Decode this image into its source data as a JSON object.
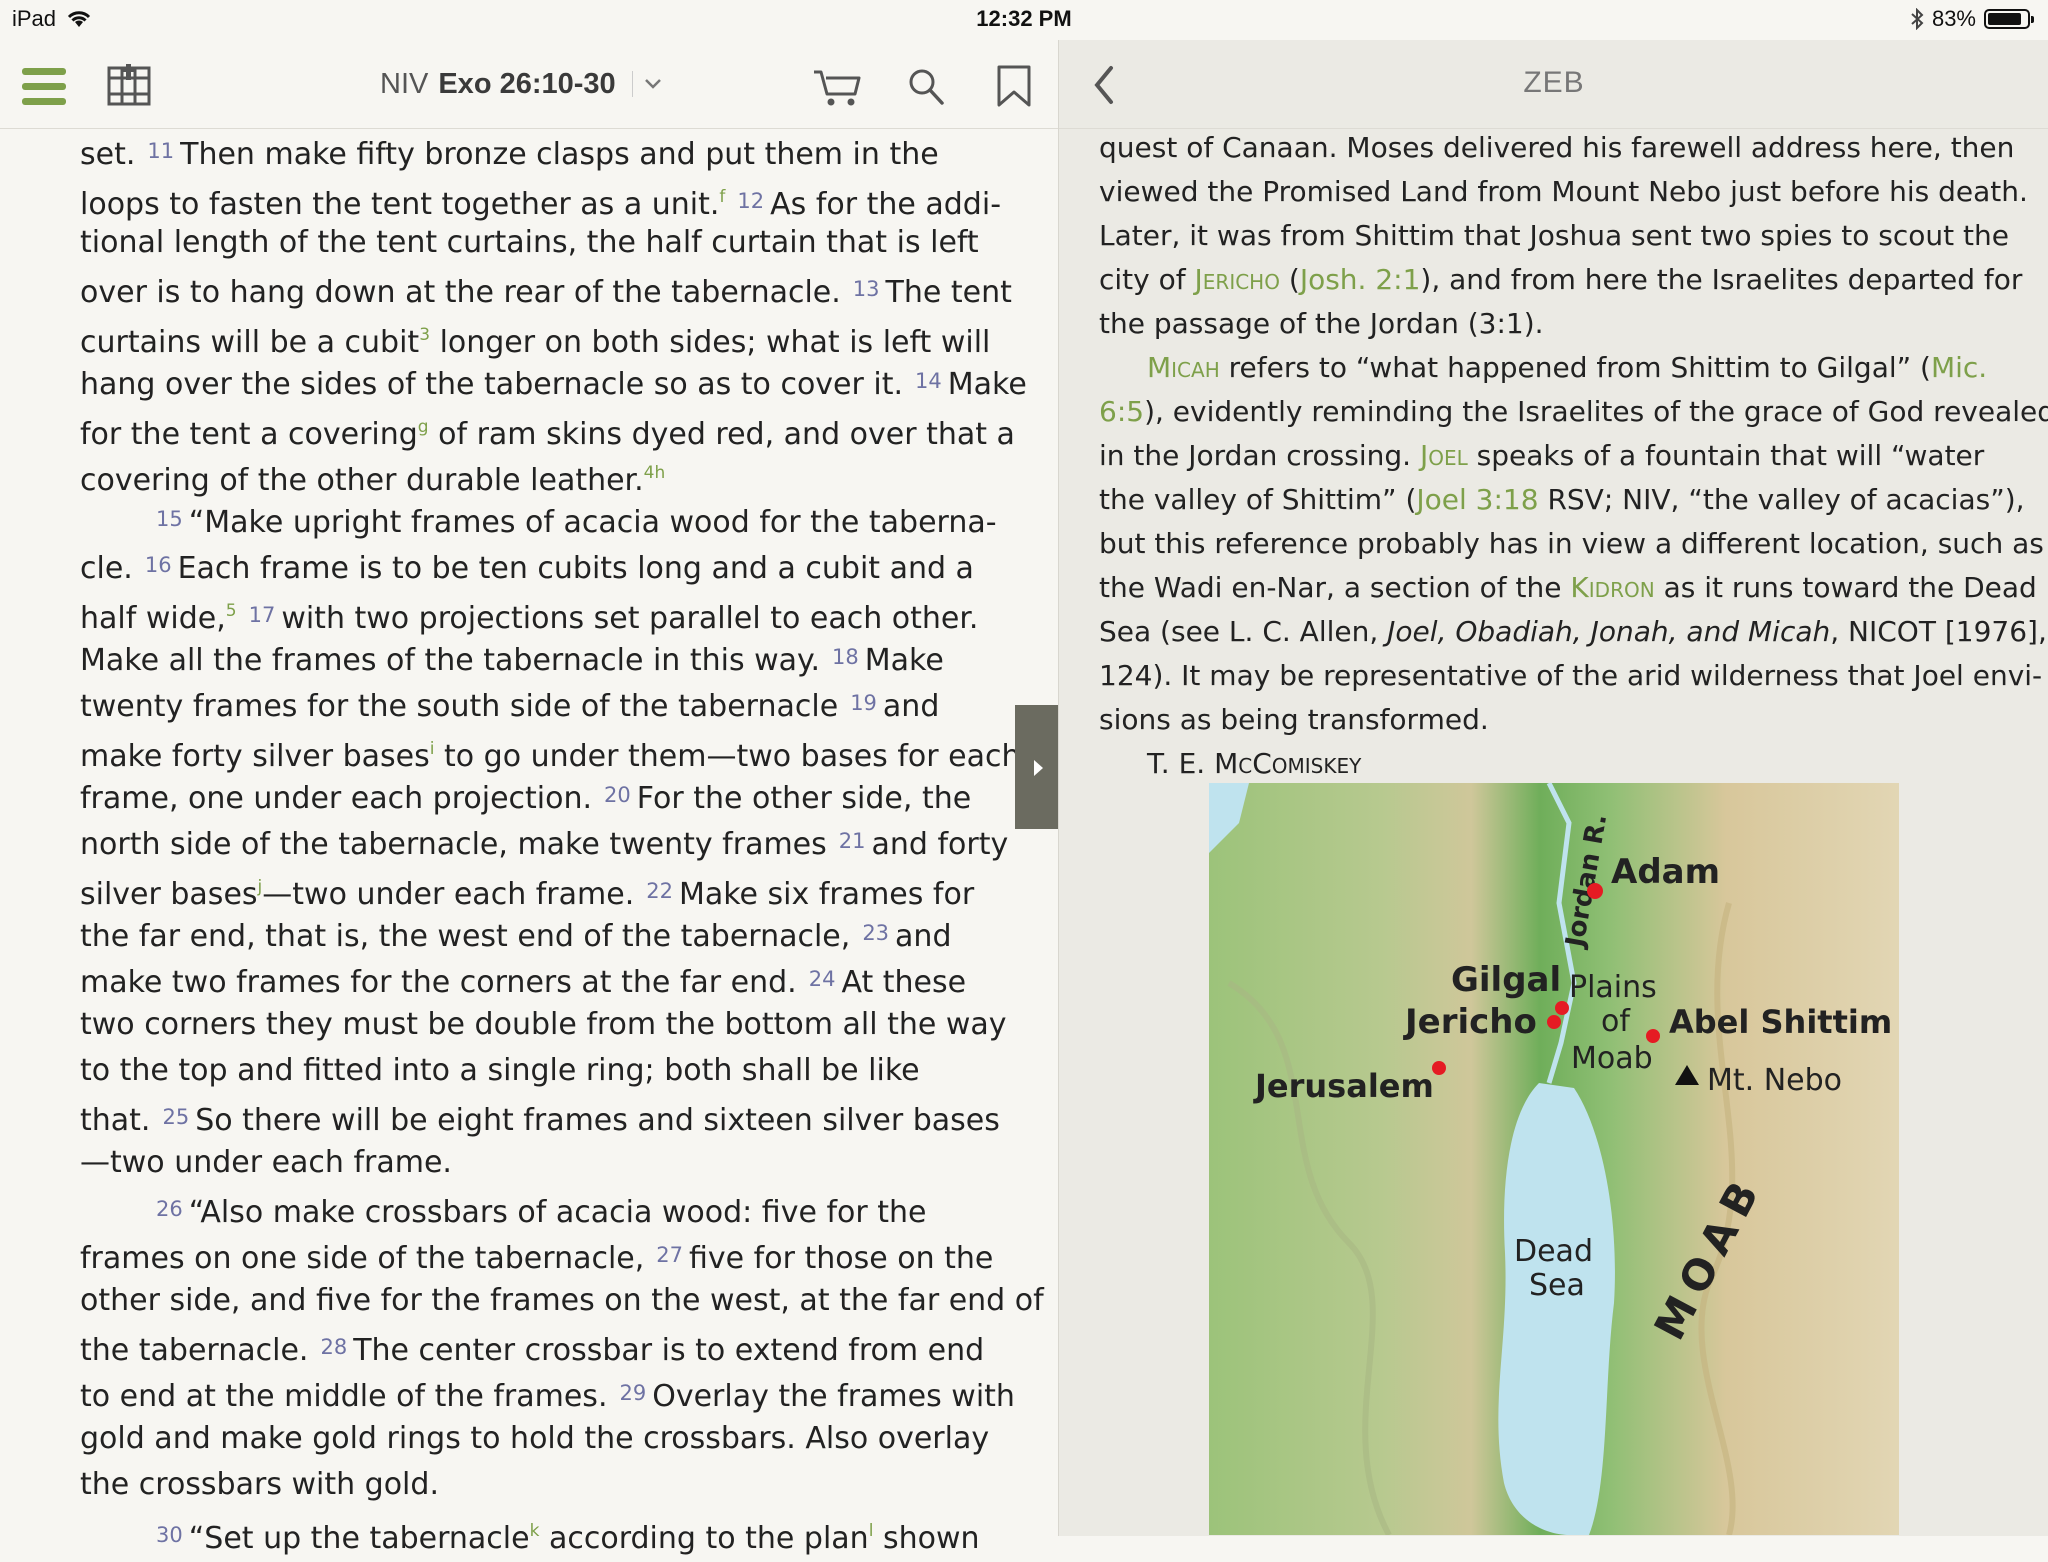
{
  "status": {
    "device": "iPad",
    "time": "12:32 PM",
    "battery": "83%",
    "battery_level": 0.83
  },
  "left_toolbar": {
    "version": "NIV",
    "reference": "Exo 26:10-30"
  },
  "right_toolbar": {
    "title": "ZEB"
  },
  "bible": {
    "l1": {
      "a": "set.",
      "v11": "11",
      "b": "Then make fifty bronze clasps and put them in the"
    },
    "l2": {
      "a": "loops to fasten the tent together as a unit.",
      "f": "f",
      "v12": "12",
      "b": "As for the addi-"
    },
    "l3": "tional length of the tent curtains, the half curtain that is left",
    "l4": {
      "a": "over is to hang down at the rear of the tabernacle.",
      "v13": "13",
      "b": "The tent"
    },
    "l5": {
      "a": "curtains will be a cubit",
      "f": "3",
      "b": "longer on both sides; what is left will"
    },
    "l6": {
      "a": "hang over the sides of the tabernacle so as to cover it.",
      "v14": "14",
      "b": "Make"
    },
    "l7": {
      "a": "for the tent a covering",
      "f": "g",
      "b": "of ram skins dyed red, and over that a"
    },
    "l8": {
      "a": "covering of the other durable leather.",
      "f": "4h"
    },
    "l9": {
      "v15": "15",
      "b": "“Make upright frames of acacia wood for the taberna-"
    },
    "l10": {
      "a": "cle.",
      "v16": "16",
      "b": "Each frame is to be ten cubits long and a cubit and a"
    },
    "l11": {
      "a": "half wide,",
      "f": "5",
      "v17": "17",
      "b": "with two projections set parallel to each other."
    },
    "l12": {
      "a": "Make all the frames of the tabernacle in this way.",
      "v18": "18",
      "b": "Make"
    },
    "l13": {
      "a": "twenty frames for the south side of the tabernacle",
      "v19": "19",
      "b": "and"
    },
    "l14": {
      "a": "make forty silver bases",
      "f": "i",
      "b": "to go under them—two bases for each"
    },
    "l15": {
      "a": "frame, one under each projection.",
      "v20": "20",
      "b": "For the other side, the"
    },
    "l16": {
      "a": "north side of the tabernacle, make twenty frames",
      "v21": "21",
      "b": "and forty"
    },
    "l17": {
      "a": "silver bases",
      "f": "j",
      "b": "—two under each frame.",
      "v22": "22",
      "c": "Make six frames for"
    },
    "l18": {
      "a": "the far end, that is, the west end of the tabernacle,",
      "v23": "23",
      "b": "and"
    },
    "l19": {
      "a": "make two frames for the corners at the far end.",
      "v24": "24",
      "b": "At these"
    },
    "l20": "two corners they must be double from the bottom all the way",
    "l21": "to the top and fitted into a single ring; both shall be like",
    "l22": {
      "a": "that.",
      "v25": "25",
      "b": "So there will be eight frames and sixteen silver bases"
    },
    "l23": "—two under each frame.",
    "l24": {
      "v26": "26",
      "b": "“Also make crossbars of acacia wood: five for the"
    },
    "l25": {
      "a": "frames on one side of the tabernacle,",
      "v27": "27",
      "b": "five for those on the"
    },
    "l26": "other side, and five for the frames on the west, at the far end of",
    "l27": {
      "a": "the tabernacle.",
      "v28": "28",
      "b": "The center crossbar is to extend from end"
    },
    "l28": {
      "a": "to end at the middle of the frames.",
      "v29": "29",
      "b": "Overlay the frames with"
    },
    "l29": "gold and make gold rings to hold the crossbars. Also overlay",
    "l30": "the crossbars with gold.",
    "l31": {
      "v30": "30",
      "b": "“Set up the tabernacle",
      "f": "k",
      "c": "according to the plan",
      "f2": "l",
      "d": "shown"
    }
  },
  "zeb": {
    "l1": "quest of Canaan. Moses delivered his farewell address here, then",
    "l2": "viewed the Promised Land from Mount Nebo just before his death.",
    "l3": "Later, it was from Shittim that Joshua sent two spies to scout the",
    "l4": {
      "a": "city of",
      "b": "Jericho",
      "c": "(",
      "d": "Josh. 2:1",
      "e": "), and from here the Israelites departed for"
    },
    "l5": "the passage of the Jordan (3:1).",
    "l6": {
      "a": "Micah",
      "b": "refers to “what happened from Shittim to Gilgal” (",
      "c": "Mic."
    },
    "l7": {
      "a": "6:5",
      "b": "), evidently reminding the Israelites of the grace of God revealed"
    },
    "l8": {
      "a": "in the Jordan crossing.",
      "b": "Joel",
      "c": "speaks of a fountain that will “water"
    },
    "l9": {
      "a": "the valley of Shittim” (",
      "b": "Joel 3:18",
      "c": "RSV; NIV, “the valley of acacias”),"
    },
    "l10": "but this reference probably has in view a different location, such as",
    "l11": {
      "a": "the Wadi en-Nar, a section of the",
      "b": "Kidron",
      "c": "as it runs toward the Dead"
    },
    "l12": {
      "a": "Sea (see L. C. Allen,",
      "b": "Joel, Obadiah, Jonah, and Micah",
      "c": ", NICOT [1976],"
    },
    "l13": "124). It may be representative of the arid wilderness that Joel envi-",
    "l14": "sions as being transformed.",
    "author": "T. E. McComiskey"
  },
  "map": {
    "labels": {
      "jordan": "Jordan R.",
      "adam": "Adam",
      "gilgal": "Gilgal",
      "plains": "Plains",
      "of": "of",
      "moab_small": "Moab",
      "jericho": "Jericho",
      "abel_shittim": "Abel Shittim",
      "jerusalem": "Jerusalem",
      "mt_nebo": "Mt. Nebo",
      "dead": "Dead",
      "sea": "Sea",
      "moab_region": "MOAB"
    },
    "colors": {
      "water": "#bfe3ee",
      "lowland": "#8fbf74",
      "highland": "#d9c89c",
      "marker": "#e51b23"
    }
  },
  "colors": {
    "accent": "#7ea04a",
    "verse_number": "#6e72a3"
  }
}
